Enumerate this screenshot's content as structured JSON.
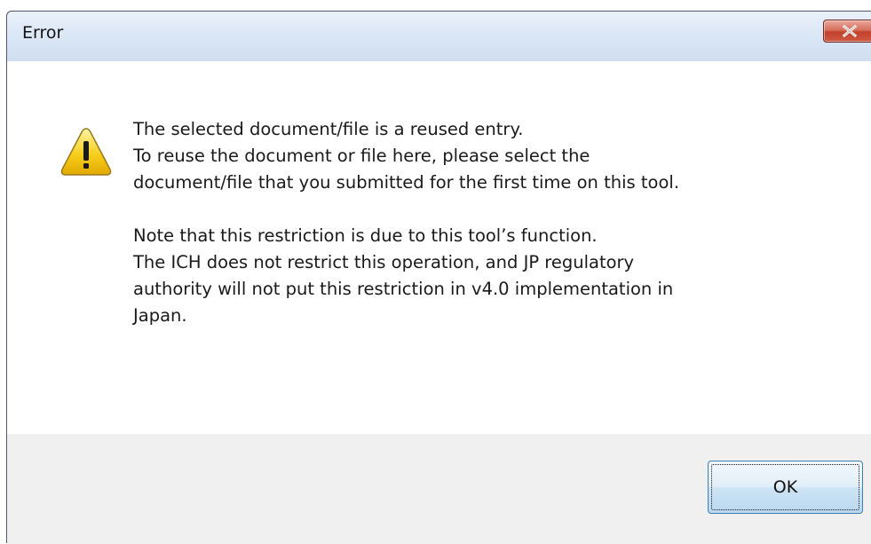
{
  "window": {
    "title": "Error"
  },
  "icons": {
    "close": "close-icon",
    "warning": "warning-icon"
  },
  "message": {
    "line1": "The selected document/file is a reused entry.",
    "line2": "To reuse the document or file here, please select the",
    "line3": "document/file that you submitted for the first time on this tool.",
    "line4": "Note that this restriction is due to this tool’s function.",
    "line5": "The ICH does not restrict this operation, and JP regulatory",
    "line6": "authority will not put this restriction in v4.0 implementation in",
    "line7": "Japan."
  },
  "buttons": {
    "ok_label": "OK"
  },
  "colors": {
    "close_button": "#c2412b",
    "warning_yellow": "#f5c400",
    "button_strip": "#f0f0f0",
    "ok_border": "#3c7fb1"
  }
}
